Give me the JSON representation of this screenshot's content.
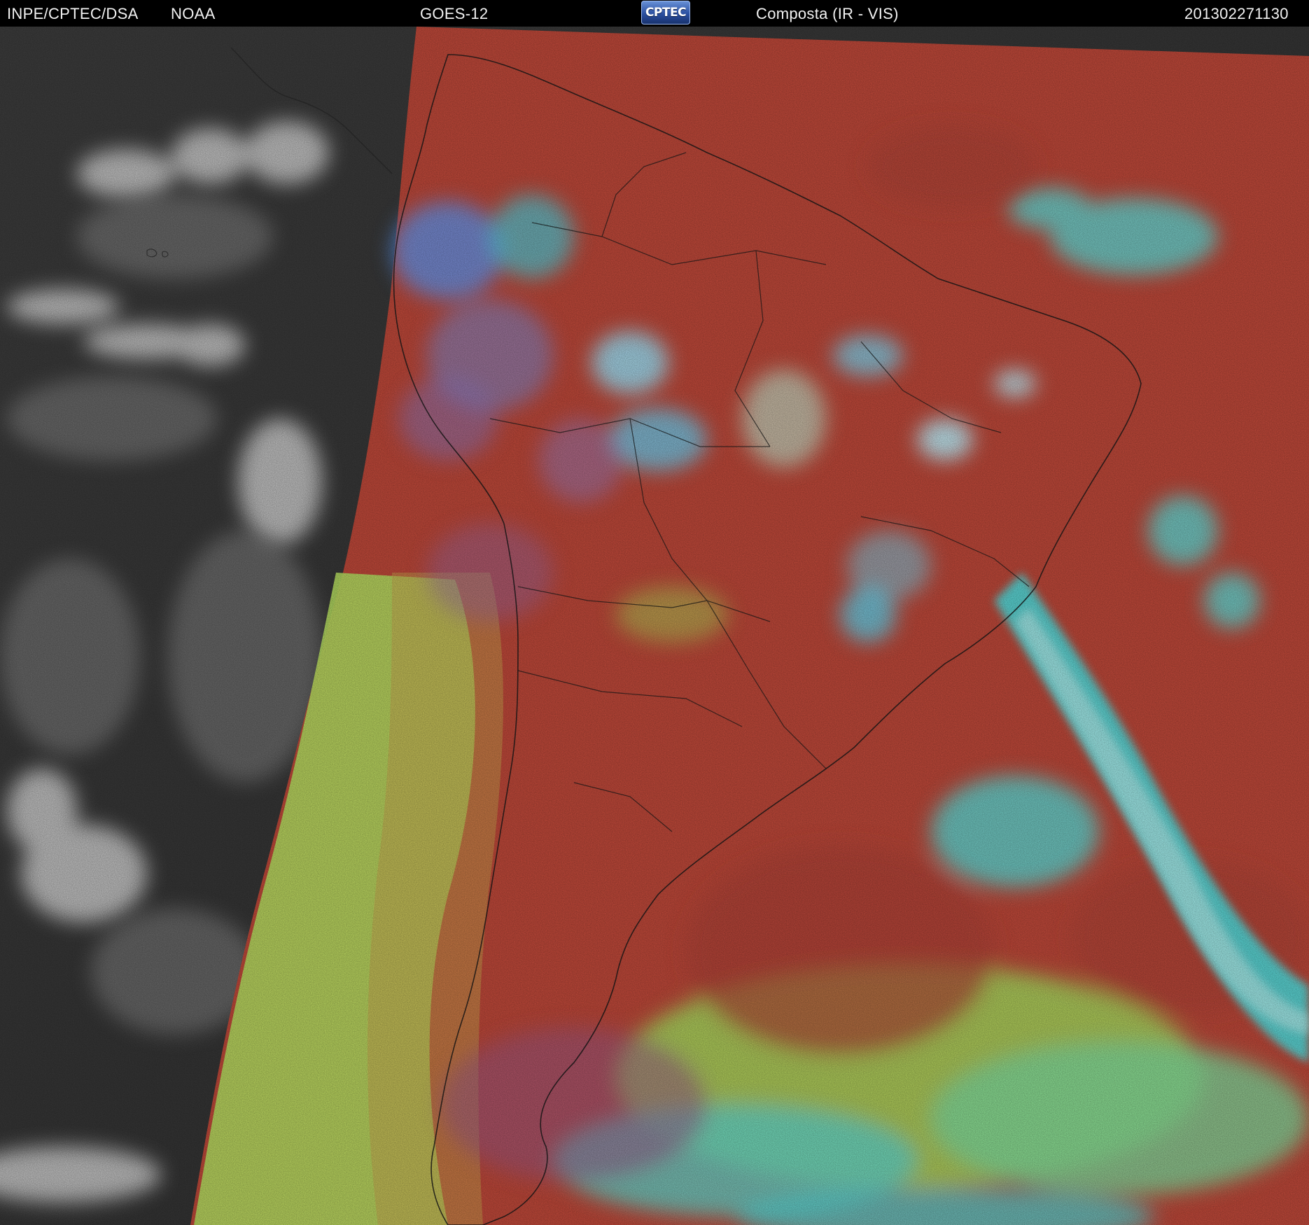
{
  "header": {
    "source_label": "INPE/CPTEC/DSA",
    "agency_label": "NOAA",
    "satellite_label": "GOES-12",
    "logo_text": "CPTEC",
    "product_label": "Composta (IR - VIS)",
    "timestamp_label": "201302271130"
  },
  "image": {
    "type": "satellite-composite",
    "region": "South America",
    "night_side_rendering": "grayscale infrared",
    "day_side_rendering": "false-color composite",
    "colors": {
      "background_text": "#f2f2f2",
      "clear_land": "#b5473a",
      "ocean_clear": "#c2473a",
      "low_clouds": "#a8e05a",
      "high_clouds": "#3fe3e6",
      "deep_convection": "#5fb0ff",
      "night_ir_background": "#3a3a3a",
      "night_ir_clouds": "#d9d9d9",
      "borders": "#111111"
    }
  }
}
